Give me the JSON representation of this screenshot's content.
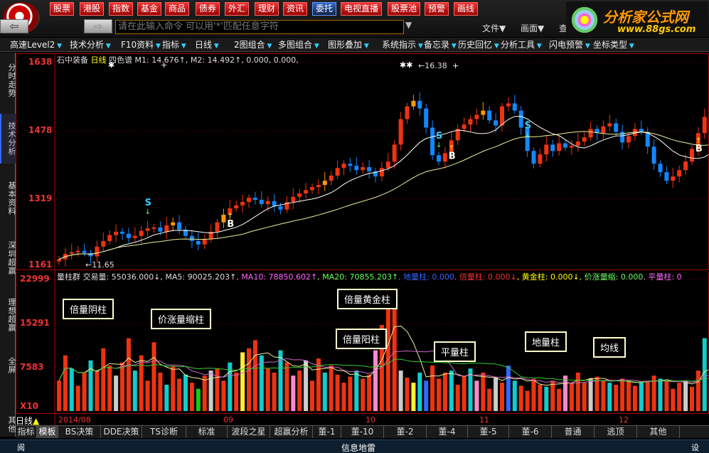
{
  "toolbar": {
    "items": [
      "股票",
      "港股",
      "指数",
      "基金",
      "商品",
      "债券",
      "外汇",
      "理财",
      "资讯",
      "委托",
      "电视直播",
      "股票池",
      "预警",
      "画线"
    ]
  },
  "nav": {
    "back": "⇦",
    "fwd": "⇨"
  },
  "command": {
    "placeholder": "请在此输入命令  可以用'*'匹配任意字符",
    "dropdown": "▼"
  },
  "rmenu": {
    "file": "文件▼",
    "view": "画面▼",
    "extra": "查"
  },
  "brand": {
    "name": "分析家公式网",
    "url": "www.88gs.com"
  },
  "bar2": {
    "items": [
      "高速Level2",
      "技术分析",
      "F10资料",
      "指标",
      "日线",
      "2图组合",
      "多图组合",
      "图形叠加",
      "系统指示",
      "备忘录",
      "历史回忆",
      "分析工具",
      "闪电预警",
      "坐标类型"
    ]
  },
  "lefttabs": [
    "分时走势",
    "技术分析",
    "基本资料",
    "深圳超赢",
    "理想超赢",
    "全屏",
    "其他"
  ],
  "price": {
    "info": [
      {
        "t": "石中装备 ",
        "c": "#ddd"
      },
      {
        "t": "日线",
        "c": "#ff0"
      },
      {
        "t": " 四色谱  ",
        "c": "#ddd"
      },
      {
        "t": "M1: 14.676↑",
        "c": "#ddd"
      },
      {
        "t": ", M2: 14.492↑",
        "c": "#ddd"
      },
      {
        "t": ", 0.000, 0.000,",
        "c": "#ddd"
      }
    ],
    "ylabels": [
      "1638",
      "1478",
      "1319",
      "1161"
    ],
    "high_label": "16.38",
    "low_label": "11.65"
  },
  "vol": {
    "info": [
      {
        "t": "量柱群 ",
        "c": "#ddd"
      },
      {
        "t": "交易量: 55036.000↓",
        "c": "#ddd"
      },
      {
        "t": ",  MA5: 90025.203↑",
        "c": "#ddd"
      },
      {
        "t": ",  MA10: 78850.602↑",
        "c": "#f6f"
      },
      {
        "t": ",  MA20: 70855.203↑",
        "c": "#6f6"
      },
      {
        "t": ",  地量柱: 0.000",
        "c": "#36f"
      },
      {
        "t": ",  倍量柱: 0.000↓",
        "c": "#e33"
      },
      {
        "t": ",  黄金柱: 0.000↓",
        "c": "#ff0"
      },
      {
        "t": ",  价涨量缩: 0.000",
        "c": "#6f6"
      },
      {
        "t": ",  平量柱: 0",
        "c": "#f6f"
      }
    ],
    "ylabels": [
      "22999",
      "15291",
      "7583",
      "X10"
    ]
  },
  "annotations": [
    "倍量阴柱",
    "价涨量缩柱",
    "倍量黄金柱",
    "倍量阳柱",
    "平量柱",
    "地量柱",
    "均线"
  ],
  "signals": {
    "s": "S",
    "b": "B"
  },
  "xaxis": {
    "left": "日线",
    "labels": [
      "2014/08",
      "09",
      "10",
      "11",
      "12"
    ]
  },
  "bottom": {
    "items": [
      "指标",
      "模板",
      "BS决策",
      "DDE决策",
      "TS诊断",
      "标准",
      "波段之星",
      "超赢分析",
      "董-1",
      "董-10",
      "董-2",
      "董-4",
      "董-5",
      "董-6",
      "普通",
      "逃顶",
      "其他"
    ]
  },
  "status": {
    "left": "阅",
    "center": "信息地雷",
    "right": "设"
  },
  "chart_data": {
    "type": "candlestick",
    "title": "石中装备 日线",
    "ylim_price": [
      11.61,
      16.38
    ],
    "ylim_volume": [
      0,
      22999
    ],
    "high": 16.38,
    "low": 11.65,
    "ma": {
      "M1": 14.676,
      "M2": 14.492
    },
    "volume_last": 55036.0,
    "MA5": 90025.203,
    "MA10": 78850.602,
    "MA20": 70855.203
  }
}
